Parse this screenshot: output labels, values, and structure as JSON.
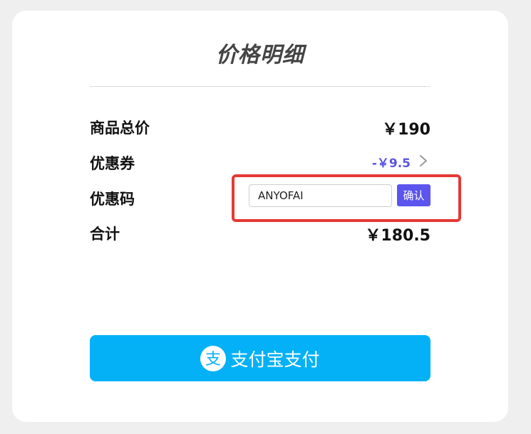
{
  "header": {
    "title": "价格明细"
  },
  "summary": {
    "subtotal_label": "商品总价",
    "subtotal_value": "￥190",
    "coupon_label": "优惠券",
    "coupon_value": "-￥9.5",
    "promo_label": "优惠码",
    "promo_code_value": "ANYOFAI",
    "promo_confirm_label": "确认",
    "total_label": "合计",
    "total_value": "￥180.5"
  },
  "payment": {
    "button_label": "支付宝支付",
    "logo_glyph": "支",
    "icon": "alipay-icon"
  },
  "colors": {
    "accent": "#5b55ee",
    "pay_button": "#05b1f6",
    "highlight": "#e53935"
  }
}
